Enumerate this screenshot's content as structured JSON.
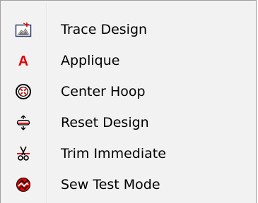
{
  "menu": {
    "items": [
      {
        "label": "Trace Design",
        "icon": "trace-design-icon"
      },
      {
        "label": "Applique",
        "icon": "applique-icon"
      },
      {
        "label": "Center Hoop",
        "icon": "center-hoop-icon"
      },
      {
        "label": "Reset Design",
        "icon": "reset-design-icon"
      },
      {
        "label": "Trim Immediate",
        "icon": "trim-immediate-icon"
      },
      {
        "label": "Sew Test Mode",
        "icon": "sew-test-mode-icon"
      }
    ],
    "colors": {
      "background": "#f2f2f2",
      "border": "#a0a0a0",
      "accent_red": "#e00000"
    }
  }
}
